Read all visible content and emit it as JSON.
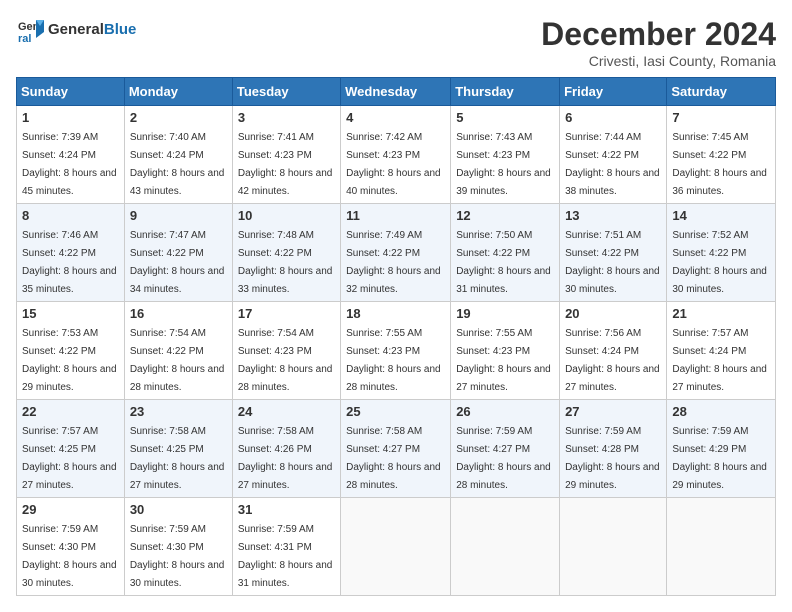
{
  "logo": {
    "general": "General",
    "blue": "Blue"
  },
  "title": "December 2024",
  "location": "Crivesti, Iasi County, Romania",
  "days_header": [
    "Sunday",
    "Monday",
    "Tuesday",
    "Wednesday",
    "Thursday",
    "Friday",
    "Saturday"
  ],
  "weeks": [
    [
      {
        "day": "1",
        "sunrise": "7:39 AM",
        "sunset": "4:24 PM",
        "daylight": "8 hours and 45 minutes."
      },
      {
        "day": "2",
        "sunrise": "7:40 AM",
        "sunset": "4:24 PM",
        "daylight": "8 hours and 43 minutes."
      },
      {
        "day": "3",
        "sunrise": "7:41 AM",
        "sunset": "4:23 PM",
        "daylight": "8 hours and 42 minutes."
      },
      {
        "day": "4",
        "sunrise": "7:42 AM",
        "sunset": "4:23 PM",
        "daylight": "8 hours and 40 minutes."
      },
      {
        "day": "5",
        "sunrise": "7:43 AM",
        "sunset": "4:23 PM",
        "daylight": "8 hours and 39 minutes."
      },
      {
        "day": "6",
        "sunrise": "7:44 AM",
        "sunset": "4:22 PM",
        "daylight": "8 hours and 38 minutes."
      },
      {
        "day": "7",
        "sunrise": "7:45 AM",
        "sunset": "4:22 PM",
        "daylight": "8 hours and 36 minutes."
      }
    ],
    [
      {
        "day": "8",
        "sunrise": "7:46 AM",
        "sunset": "4:22 PM",
        "daylight": "8 hours and 35 minutes."
      },
      {
        "day": "9",
        "sunrise": "7:47 AM",
        "sunset": "4:22 PM",
        "daylight": "8 hours and 34 minutes."
      },
      {
        "day": "10",
        "sunrise": "7:48 AM",
        "sunset": "4:22 PM",
        "daylight": "8 hours and 33 minutes."
      },
      {
        "day": "11",
        "sunrise": "7:49 AM",
        "sunset": "4:22 PM",
        "daylight": "8 hours and 32 minutes."
      },
      {
        "day": "12",
        "sunrise": "7:50 AM",
        "sunset": "4:22 PM",
        "daylight": "8 hours and 31 minutes."
      },
      {
        "day": "13",
        "sunrise": "7:51 AM",
        "sunset": "4:22 PM",
        "daylight": "8 hours and 30 minutes."
      },
      {
        "day": "14",
        "sunrise": "7:52 AM",
        "sunset": "4:22 PM",
        "daylight": "8 hours and 30 minutes."
      }
    ],
    [
      {
        "day": "15",
        "sunrise": "7:53 AM",
        "sunset": "4:22 PM",
        "daylight": "8 hours and 29 minutes."
      },
      {
        "day": "16",
        "sunrise": "7:54 AM",
        "sunset": "4:22 PM",
        "daylight": "8 hours and 28 minutes."
      },
      {
        "day": "17",
        "sunrise": "7:54 AM",
        "sunset": "4:23 PM",
        "daylight": "8 hours and 28 minutes."
      },
      {
        "day": "18",
        "sunrise": "7:55 AM",
        "sunset": "4:23 PM",
        "daylight": "8 hours and 28 minutes."
      },
      {
        "day": "19",
        "sunrise": "7:55 AM",
        "sunset": "4:23 PM",
        "daylight": "8 hours and 27 minutes."
      },
      {
        "day": "20",
        "sunrise": "7:56 AM",
        "sunset": "4:24 PM",
        "daylight": "8 hours and 27 minutes."
      },
      {
        "day": "21",
        "sunrise": "7:57 AM",
        "sunset": "4:24 PM",
        "daylight": "8 hours and 27 minutes."
      }
    ],
    [
      {
        "day": "22",
        "sunrise": "7:57 AM",
        "sunset": "4:25 PM",
        "daylight": "8 hours and 27 minutes."
      },
      {
        "day": "23",
        "sunrise": "7:58 AM",
        "sunset": "4:25 PM",
        "daylight": "8 hours and 27 minutes."
      },
      {
        "day": "24",
        "sunrise": "7:58 AM",
        "sunset": "4:26 PM",
        "daylight": "8 hours and 27 minutes."
      },
      {
        "day": "25",
        "sunrise": "7:58 AM",
        "sunset": "4:27 PM",
        "daylight": "8 hours and 28 minutes."
      },
      {
        "day": "26",
        "sunrise": "7:59 AM",
        "sunset": "4:27 PM",
        "daylight": "8 hours and 28 minutes."
      },
      {
        "day": "27",
        "sunrise": "7:59 AM",
        "sunset": "4:28 PM",
        "daylight": "8 hours and 29 minutes."
      },
      {
        "day": "28",
        "sunrise": "7:59 AM",
        "sunset": "4:29 PM",
        "daylight": "8 hours and 29 minutes."
      }
    ],
    [
      {
        "day": "29",
        "sunrise": "7:59 AM",
        "sunset": "4:30 PM",
        "daylight": "8 hours and 30 minutes."
      },
      {
        "day": "30",
        "sunrise": "7:59 AM",
        "sunset": "4:30 PM",
        "daylight": "8 hours and 30 minutes."
      },
      {
        "day": "31",
        "sunrise": "7:59 AM",
        "sunset": "4:31 PM",
        "daylight": "8 hours and 31 minutes."
      },
      null,
      null,
      null,
      null
    ]
  ]
}
